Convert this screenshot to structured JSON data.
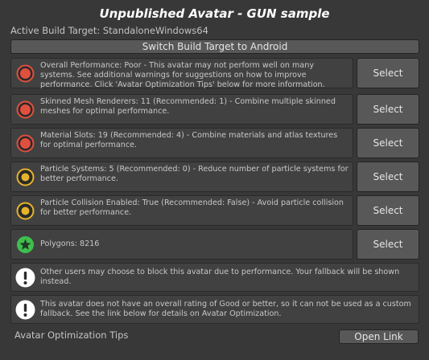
{
  "header": {
    "title": "Unpublished Avatar - GUN sample",
    "build_target": "Active Build Target: StandaloneWindows64",
    "switch_button": "Switch Build Target to Android"
  },
  "rows": [
    {
      "status": "poor",
      "icon": "red-circle-icon",
      "message": "Overall Performance: Poor - This avatar may not perform well on many systems. See additional warnings for suggestions on how to improve performance. Click 'Avatar Optimization Tips' below for more information.",
      "button": "Select"
    },
    {
      "status": "poor",
      "icon": "red-circle-icon",
      "message": "Skinned Mesh Renderers: 11 (Recommended: 1) - Combine multiple skinned meshes for optimal performance.",
      "button": "Select"
    },
    {
      "status": "poor",
      "icon": "red-circle-icon",
      "message": "Material Slots: 19 (Recommended: 4) - Combine materials and atlas textures for optimal performance.",
      "button": "Select"
    },
    {
      "status": "medium",
      "icon": "yellow-circle-icon",
      "message": "Particle Systems: 5 (Recommended: 0) - Reduce number of particle systems for better performance.",
      "button": "Select"
    },
    {
      "status": "medium",
      "icon": "yellow-circle-icon",
      "message": "Particle Collision Enabled: True (Recommended: False) - Avoid particle collision for better performance.",
      "button": "Select"
    },
    {
      "status": "excellent",
      "icon": "green-star-icon",
      "message": "Polygons: 8216",
      "button": "Select"
    }
  ],
  "info": [
    {
      "icon": "exclamation-icon",
      "message": "Other users may choose to block this avatar due to performance. Your fallback will be shown instead."
    },
    {
      "icon": "exclamation-icon",
      "message": "This avatar does not have an overall rating of Good or better, so it can not be used as a custom fallback. See the link below for details on Avatar Optimization."
    }
  ],
  "footer": {
    "tips_label": "Avatar Optimization Tips",
    "open_link": "Open Link"
  },
  "colors": {
    "poor": "#e0503f",
    "medium": "#e6b32a",
    "excellent": "#3fbf4f",
    "background": "#383838"
  }
}
